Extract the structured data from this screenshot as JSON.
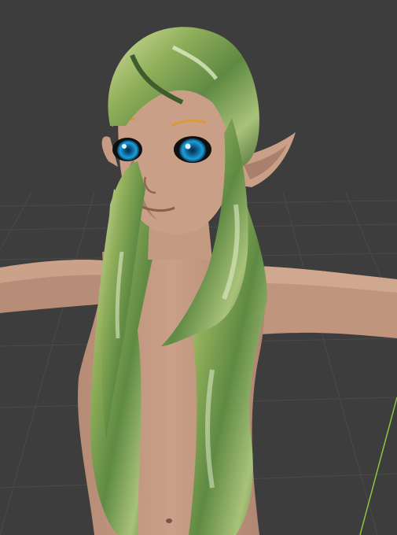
{
  "viewport": {
    "view": "3d-viewport",
    "colors": {
      "background": "#3d3d3d",
      "grid_line": "#4a4a4a",
      "y_axis": "#8cc63f",
      "skin": "#c9a087",
      "skin_shadow": "#9a7564",
      "hair_base": "#8fae5a",
      "hair_dark": "#4f6f3a",
      "hair_light": "#e8f0d0",
      "eye_iris": "#1aa0d8"
    },
    "object": {
      "type": "character-model",
      "pose": "t-pose",
      "parts": [
        "head",
        "hair",
        "ears",
        "eyes",
        "torso",
        "arms"
      ]
    }
  }
}
